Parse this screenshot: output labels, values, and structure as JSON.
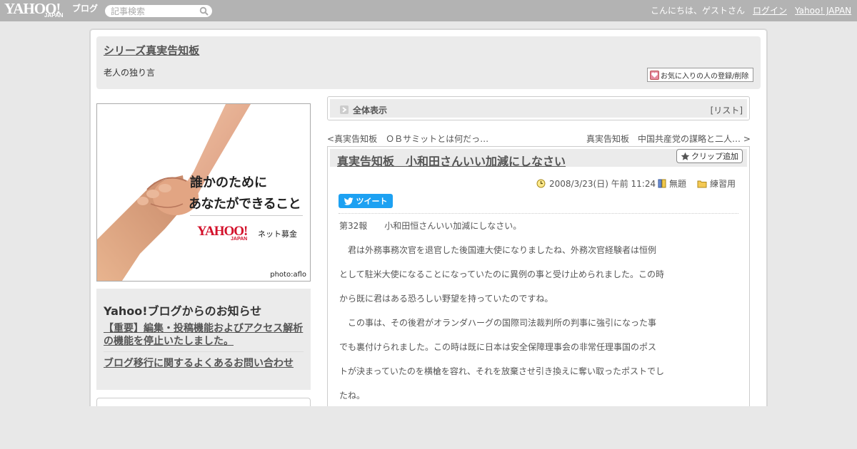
{
  "topbar": {
    "logo_text": "YAHOO!",
    "logo_sub": "JAPAN",
    "logo_blog": "ブログ",
    "search_placeholder": "記事検索",
    "greeting": "こんにちは、ゲストさん",
    "login_label": "ログイン",
    "yahoo_japan_label": "Yahoo! JAPAN"
  },
  "header": {
    "blog_title": "シリーズ真実告知板",
    "blog_description": "老人の独り言",
    "favorite_button": "お気に入りの人の登録/削除"
  },
  "banner": {
    "line1": "誰かのために",
    "line2": "あなたができること",
    "brand": "YAHOO!",
    "brand_sub": "JAPAN",
    "service": "ネット募金",
    "credit": "photo:aflo"
  },
  "notice": {
    "heading": "Yahoo!ブログからのお知らせ",
    "item1": "【重要】編集・投稿機能およびアクセス解析の機能を停止いたしました。",
    "item2": "ブログ移行に関するよくあるお問い合わせ"
  },
  "view_all": {
    "label": "全体表示",
    "list_prefix": "[",
    "list_link": "リスト",
    "list_suffix": "]"
  },
  "pager": {
    "prev_marker": "<",
    "prev_title": "真実告知板　ＯＢサミットとは何だっ…",
    "next_title": "真実告知板　中国共産党の謀略と二人…",
    "next_marker": ">"
  },
  "post": {
    "title": "真実告知板　小和田さんいい加減にしなさい",
    "clip_button": "クリップ追加",
    "date": "2008/3/23(日) 午前 11:24",
    "tag": "無題",
    "category": "練習用",
    "tweet_label": "ツイート",
    "body": [
      "第32報　　小和田恒さんいい加減にしなさい。",
      "　君は外務事務次官を退官した後国連大使になりましたね、外務次官経験者は恒例",
      "として駐米大使になることになっていたのに異例の事と受け止められました。この時",
      "から既に君はある恐ろしい野望を持っていたのですね。",
      "　この事は、その後君がオランダハーグの国際司法裁判所の判事に強引になった事",
      "でも裏付けられました。この時は既に日本は安全保障理事会の非常任理事国のポス",
      "トが決まっていたのを横槍を容れ、それを放棄させ引き換えに奪い取ったポストでし",
      "たね。"
    ]
  },
  "colors": {
    "topbar": "#b3b3b3",
    "panel": "#ebebeb",
    "tweet": "#1da1f2",
    "banner_brand": "#d3112b"
  }
}
